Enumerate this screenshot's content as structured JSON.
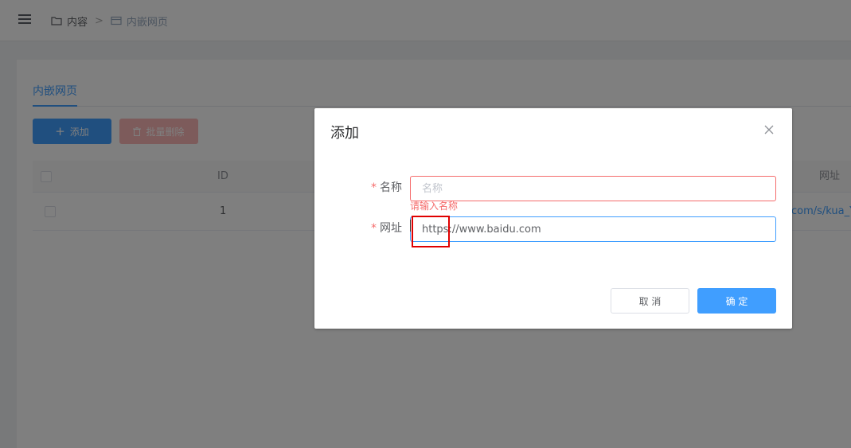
{
  "breadcrumb": {
    "items": [
      {
        "label": "内容",
        "icon": "folder-icon"
      },
      {
        "label": "内嵌网页",
        "icon": "window-icon"
      }
    ],
    "separator": ">"
  },
  "tabs": [
    {
      "label": "内嵌网页",
      "active": true
    }
  ],
  "toolbar": {
    "add_label": "添加",
    "add_icon": "+",
    "batch_delete_label": "批量删除"
  },
  "table": {
    "columns": [
      "ID",
      "网址"
    ],
    "rows": [
      {
        "id": "1",
        "url": "com/s/kua_Y"
      }
    ]
  },
  "dialog": {
    "title": "添加",
    "fields": {
      "name": {
        "label": "名称",
        "required_mark": "*",
        "placeholder": "名称",
        "value": "",
        "error": "请输入名称"
      },
      "url": {
        "label": "网址",
        "required_mark": "*",
        "value": "https://www.baidu.com"
      }
    },
    "cancel_label": "取 消",
    "confirm_label": "确 定"
  },
  "colors": {
    "primary": "#409eff",
    "danger": "#f56c6c",
    "danger_light": "#fab6b6",
    "annotation": "#e00000"
  }
}
